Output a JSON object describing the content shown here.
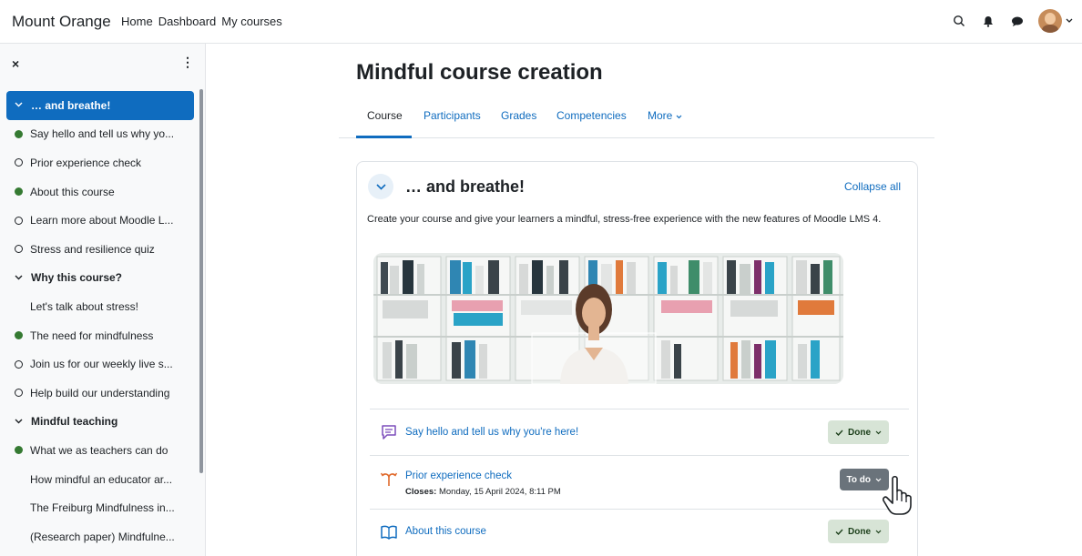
{
  "navbar": {
    "brand": "Mount Orange",
    "links": [
      "Home",
      "Dashboard",
      "My courses"
    ],
    "icons": [
      "search-icon",
      "bell-icon",
      "chat-icon",
      "avatar",
      "chevron-down-icon"
    ]
  },
  "sidebar": {
    "close_label": "×",
    "menu_label": "⋮",
    "items": [
      {
        "label": "… and breathe!",
        "kind": "section-active"
      },
      {
        "label": "Say hello and tell us why yo...",
        "kind": "done"
      },
      {
        "label": "Prior experience check",
        "kind": "todo"
      },
      {
        "label": "About this course",
        "kind": "done"
      },
      {
        "label": "Learn more about Moodle L...",
        "kind": "todo"
      },
      {
        "label": "Stress and resilience quiz",
        "kind": "todo"
      },
      {
        "label": "Why this course?",
        "kind": "section"
      },
      {
        "label": "Let's talk about stress!",
        "kind": "plain"
      },
      {
        "label": "The need for mindfulness",
        "kind": "done"
      },
      {
        "label": "Join us for our weekly live s...",
        "kind": "todo"
      },
      {
        "label": "Help build our understanding",
        "kind": "todo"
      },
      {
        "label": "Mindful teaching",
        "kind": "section"
      },
      {
        "label": "What we as teachers can do",
        "kind": "done"
      },
      {
        "label": "How mindful an educator ar...",
        "kind": "plain"
      },
      {
        "label": "The Freiburg Mindfulness in...",
        "kind": "plain"
      },
      {
        "label": "(Research paper) Mindfulne...",
        "kind": "plain"
      }
    ]
  },
  "course": {
    "title": "Mindful course creation",
    "tabs": [
      "Course",
      "Participants",
      "Grades",
      "Competencies",
      "More"
    ],
    "section": {
      "title": "… and breathe!",
      "collapse_all": "Collapse all",
      "description": "Create your course and give your learners a mindful, stress-free experience with the new features of Moodle LMS 4."
    },
    "activities": [
      {
        "name": "Say hello and tell us why you're here!",
        "status": "Done",
        "icon": "forum-icon"
      },
      {
        "name": "Prior experience check",
        "meta_label": "Closes:",
        "meta_value": " Monday, 15 April 2024, 8:11 PM",
        "status": "To do",
        "icon": "choice-icon"
      },
      {
        "name": "About this course",
        "status": "Done",
        "icon": "book-icon"
      }
    ]
  },
  "colors": {
    "accent": "#0f6cbf",
    "done": "#357a32",
    "done_badge_bg": "#d7e4d6",
    "todo_badge_bg": "#6a737b"
  }
}
